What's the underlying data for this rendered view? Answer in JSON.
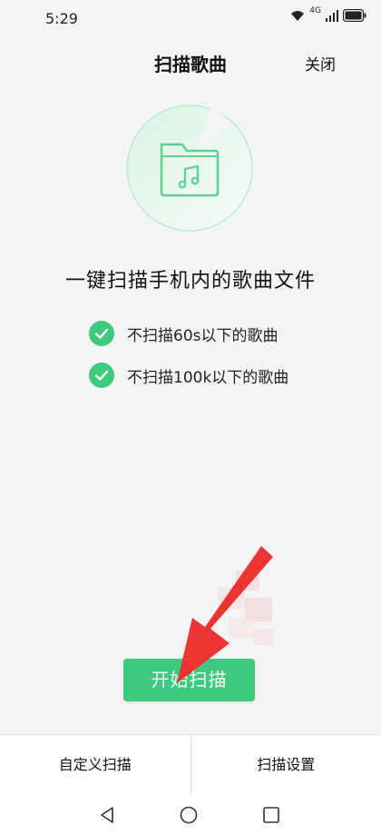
{
  "status_bar": {
    "time": "5:29",
    "network": "4G",
    "icons": [
      "wifi-icon",
      "signal-icon",
      "battery-icon"
    ]
  },
  "header": {
    "title": "扫描歌曲",
    "close_label": "关闭"
  },
  "illustration": {
    "icon": "music-folder-icon"
  },
  "main": {
    "headline": "一键扫描手机内的歌曲文件",
    "options": [
      {
        "label": "不扫描60s以下的歌曲",
        "checked": true
      },
      {
        "label": "不扫描100k以下的歌曲",
        "checked": true
      }
    ],
    "start_button": "开始扫描"
  },
  "bottom_bar": {
    "custom_scan": "自定义扫描",
    "scan_settings": "扫描设置"
  },
  "nav_bar": {
    "icons": [
      "back-icon",
      "home-icon",
      "recent-apps-icon"
    ]
  },
  "colors": {
    "accent": "#3ec97e",
    "annotation": "#ee3333",
    "background": "#f4f4f4"
  }
}
